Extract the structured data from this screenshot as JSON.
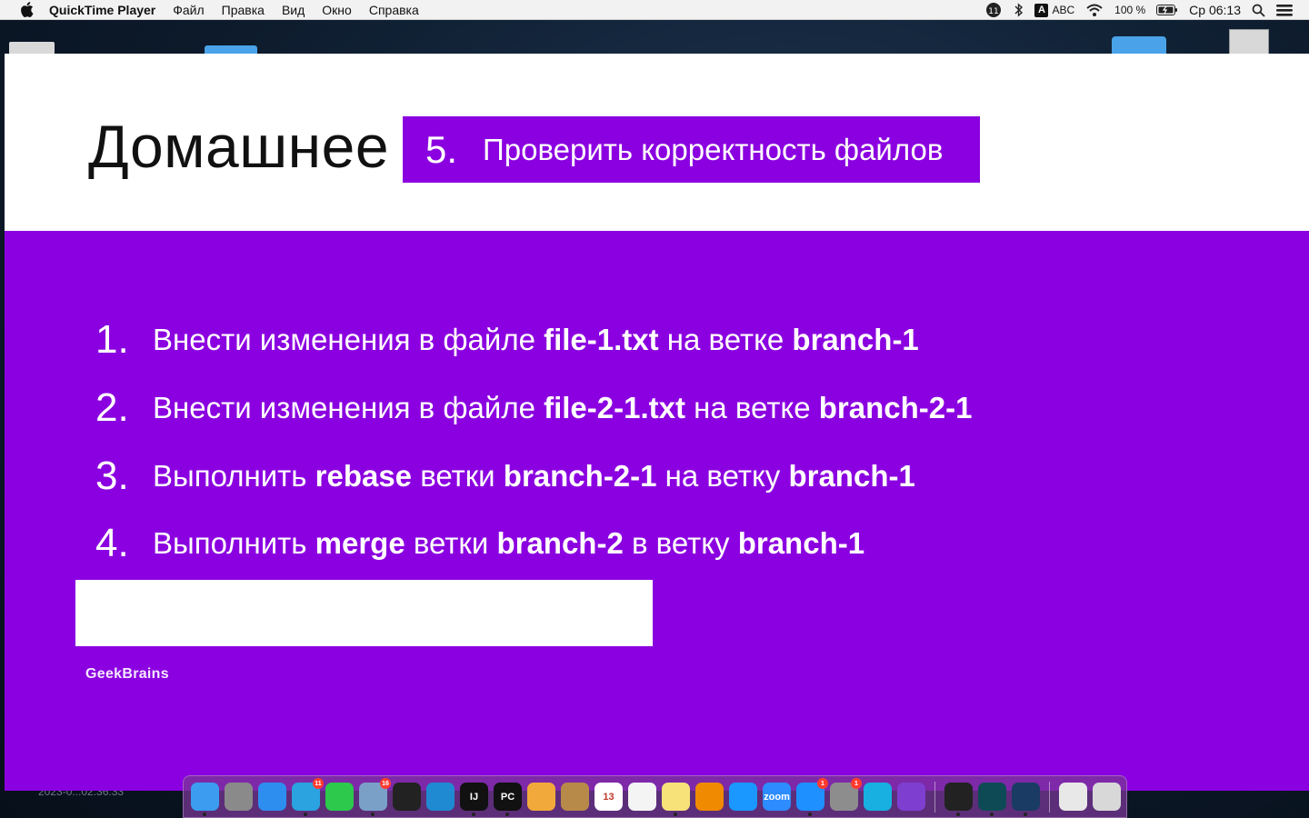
{
  "menubar": {
    "app_name": "QuickTime Player",
    "items": [
      "Файл",
      "Правка",
      "Вид",
      "Окно",
      "Справка"
    ],
    "status": {
      "notification_count": "11",
      "input_source": "ABC",
      "input_letter": "A",
      "battery": "100 %",
      "clock": "Ср 06:13"
    }
  },
  "slide": {
    "title": "Домашнее",
    "step": {
      "number": "5.",
      "text": "Проверить корректность файлов"
    },
    "tasks": [
      {
        "num": "1.",
        "parts": [
          {
            "t": "Внести изменения в файле ",
            "b": false
          },
          {
            "t": "file-1.txt",
            "b": true
          },
          {
            "t": " на ветке ",
            "b": false
          },
          {
            "t": "branch-1",
            "b": true
          }
        ]
      },
      {
        "num": "2.",
        "parts": [
          {
            "t": "Внести изменения в файле ",
            "b": false
          },
          {
            "t": "file-2-1.txt",
            "b": true
          },
          {
            "t": " на ветке ",
            "b": false
          },
          {
            "t": "branch-2-1",
            "b": true
          }
        ]
      },
      {
        "num": "3.",
        "parts": [
          {
            "t": "Выполнить ",
            "b": false
          },
          {
            "t": "rebase",
            "b": true
          },
          {
            "t": " ветки ",
            "b": false
          },
          {
            "t": "branch-2-1",
            "b": true
          },
          {
            "t": " на ветку ",
            "b": false
          },
          {
            "t": "branch-1",
            "b": true
          }
        ]
      },
      {
        "num": "4.",
        "parts": [
          {
            "t": "Выполнить ",
            "b": false
          },
          {
            "t": "merge",
            "b": true
          },
          {
            "t": " ветки ",
            "b": false
          },
          {
            "t": "branch-2",
            "b": true
          },
          {
            "t": " в ветку ",
            "b": false
          },
          {
            "t": "branch-1",
            "b": true
          }
        ]
      }
    ],
    "brand": "GeekBrains"
  },
  "desktop": {
    "caption": "2023-0...02.36.33"
  },
  "colors": {
    "slide_purple": "#8b00e0",
    "header_white": "#ffffff"
  },
  "dock": {
    "apps": [
      {
        "name": "finder-icon",
        "color": "#3b9cf0"
      },
      {
        "name": "launchpad-icon",
        "color": "#8a8a8a"
      },
      {
        "name": "safari-icon",
        "color": "#2d8ef0"
      },
      {
        "name": "telegram-icon",
        "color": "#2aa3e0",
        "badge": "11"
      },
      {
        "name": "facetime-icon",
        "color": "#2cc94c"
      },
      {
        "name": "preview-icon",
        "color": "#7aa0c8",
        "badge": "16"
      },
      {
        "name": "terminal-icon",
        "color": "#222222"
      },
      {
        "name": "vscode-icon",
        "color": "#1f8ad2"
      },
      {
        "name": "intellij-icon",
        "color": "#111111",
        "label": "IJ"
      },
      {
        "name": "pycharm-icon",
        "color": "#111111",
        "label": "PC"
      },
      {
        "name": "photos-icon",
        "color": "#f2a93b"
      },
      {
        "name": "contacts-icon",
        "color": "#b88a4a"
      },
      {
        "name": "calendar-icon",
        "color": "#ffffff",
        "label": "13"
      },
      {
        "name": "reminders-icon",
        "color": "#f4f4f4"
      },
      {
        "name": "notes-icon",
        "color": "#f7e27a"
      },
      {
        "name": "vlc-icon",
        "color": "#f08a00"
      },
      {
        "name": "prime-video-icon",
        "color": "#1a98ff"
      },
      {
        "name": "zoom-icon",
        "color": "#2d8cff",
        "label": "zoom"
      },
      {
        "name": "app-store-icon",
        "color": "#1e90ff",
        "badge": "1"
      },
      {
        "name": "system-preferences-icon",
        "color": "#8d8d8d",
        "badge": "1"
      },
      {
        "name": "copilot-icon",
        "color": "#18b0e0"
      },
      {
        "name": "github-desktop-icon",
        "color": "#7e3fd0"
      },
      {
        "name": "activity-monitor-icon",
        "color": "#222222"
      },
      {
        "name": "gitkraken-icon",
        "color": "#0e4a55"
      },
      {
        "name": "quicktime-icon",
        "color": "#1a3b63"
      },
      {
        "name": "document-icon",
        "color": "#e8e8e8"
      },
      {
        "name": "trash-icon",
        "color": "#d8d8d8"
      }
    ]
  }
}
